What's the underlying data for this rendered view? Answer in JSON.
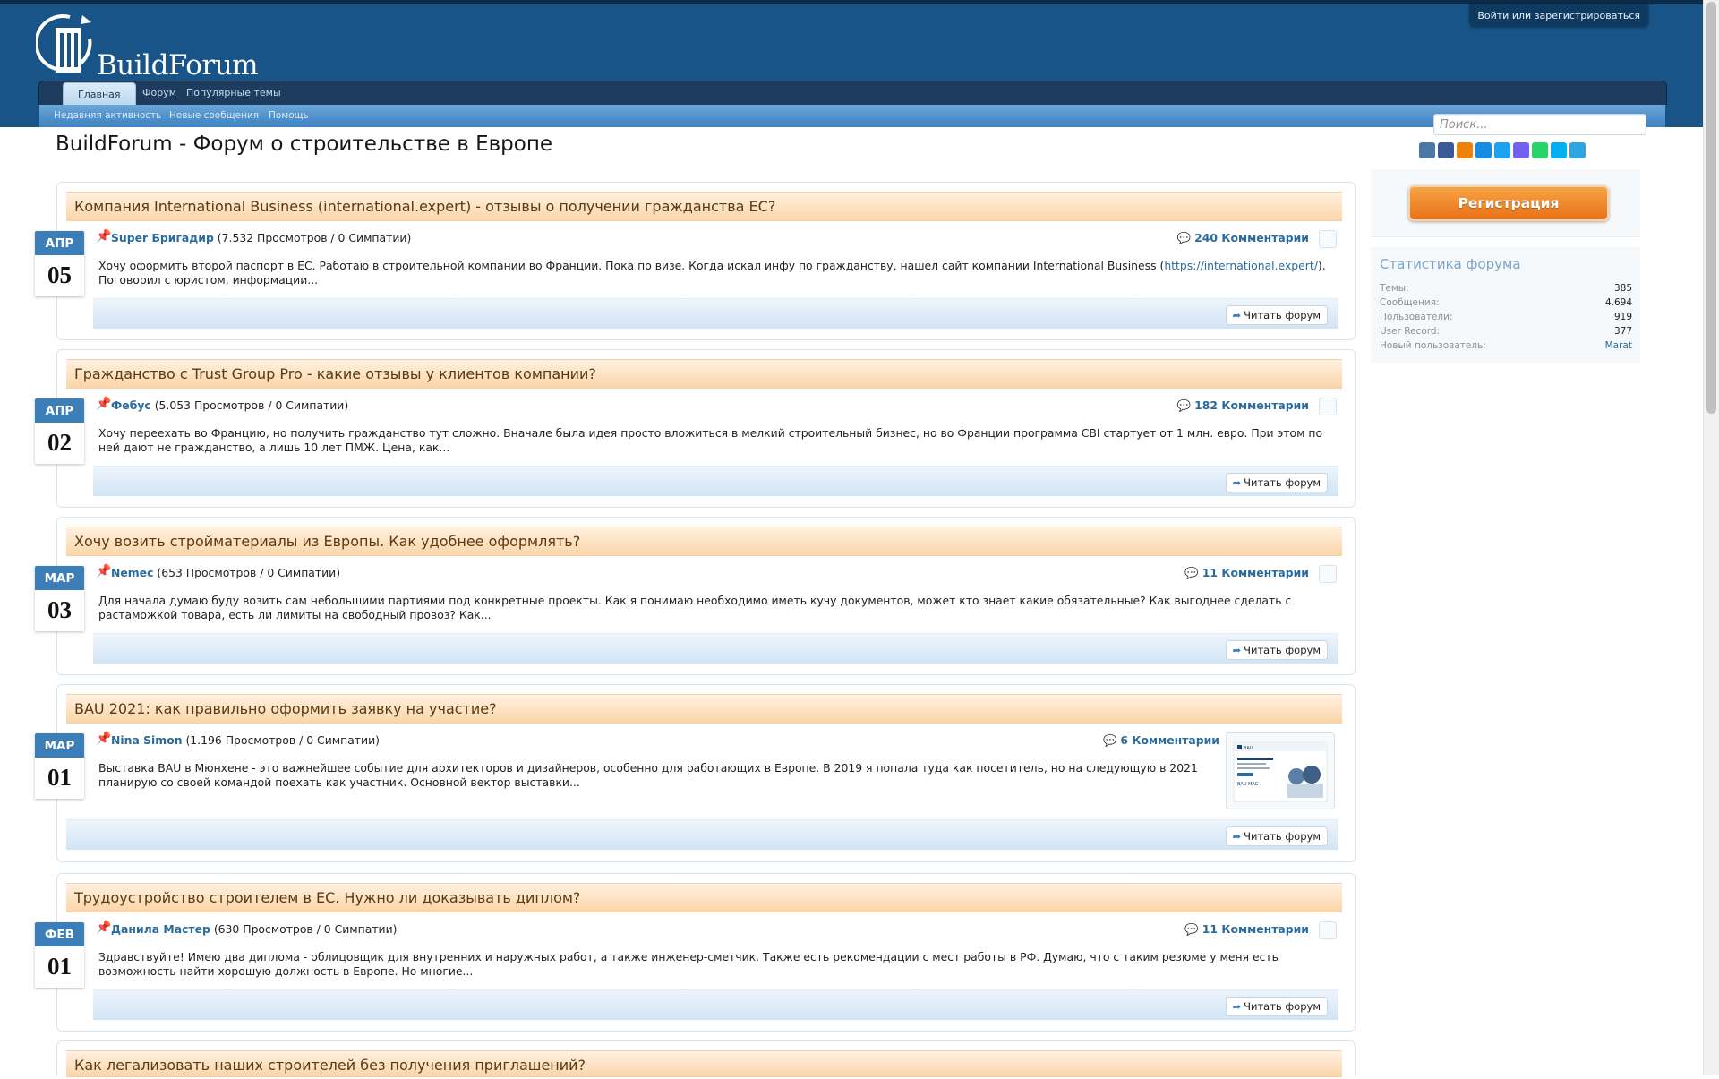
{
  "header": {
    "login_link": "Войти или зарегистрироваться",
    "logo_text": "BuildForum"
  },
  "nav": {
    "tabs": [
      {
        "label": "Главная",
        "active": true
      },
      {
        "label": "Форум"
      },
      {
        "label": "Популярные темы"
      }
    ],
    "subnav": [
      "Недавняя активность",
      "Новые сообщения",
      "Помощь"
    ]
  },
  "search": {
    "placeholder": "Поиск..."
  },
  "share_icons": [
    "vk-icon",
    "facebook-icon",
    "odnoklassniki-icon",
    "moimir-icon",
    "twitter-icon",
    "viber-icon",
    "whatsapp-icon",
    "skype-icon",
    "telegram-icon"
  ],
  "page_title": "BuildForum - Форум о строительстве в Европе",
  "threads": [
    {
      "title": "Компания International Business (international.expert) - отзывы о получении гражданства ЕС?",
      "user": "Super Бригадир",
      "stats": " (7.532 Просмотров / 0 Симпатии)",
      "comments": "240 Комментарии",
      "month": "АПР",
      "day": "05",
      "excerpt_before": "Хочу оформить второй паспорт в ЕС. Работаю в строительной компании во Франции. Пока по визе. Когда искал инфу по гражданству, нашел сайт компании International Business (",
      "excerpt_link": "https://international.expert/",
      "excerpt_after": "). Поговорил с юристом, информации...",
      "read_label": "Читать форум"
    },
    {
      "title": "Гражданство с Trust Group Pro - какие отзывы у клиентов компании?",
      "user": "Фебус",
      "stats": " (5.053 Просмотров / 0 Симпатии)",
      "comments": "182 Комментарии",
      "month": "АПР",
      "day": "02",
      "excerpt": "Хочу переехать во Францию, но получить гражданство тут сложно. Вначале была идея просто вложиться в мелкий строительный бизнес, но во Франции программа CBI стартует от 1 млн. евро. При этом по ней дают не гражданство, а лишь 10 лет ПМЖ. Цена, как...",
      "read_label": "Читать форум"
    },
    {
      "title": "Хочу возить стройматериалы из Европы. Как удобнее оформлять?",
      "user": "Nemec",
      "stats": " (653 Просмотров / 0 Симпатии)",
      "comments": "11 Комментарии",
      "month": "МАР",
      "day": "03",
      "excerpt": "Для начала думаю буду возить сам небольшими партиями под конкретные проекты. Как я понимаю необходимо иметь кучу документов, может кто знает какие обязательные? Как выгоднее сделать с растаможкой товара, есть ли лимиты на свободный провоз? Как...",
      "read_label": "Читать форум"
    },
    {
      "title": "BAU 2021: как правильно оформить заявку на участие?",
      "user": "Nina Simon",
      "stats": " (1.196 Просмотров / 0 Симпатии)",
      "comments": "6 Комментарии",
      "month": "МАР",
      "day": "01",
      "excerpt": "Выставка BAU в Мюнхене - это важнейшее событие для архитекторов и дизайнеров, особенно для работающих в Европе. В 2019 я попала туда как посетитель, но на следующую в 2021 планирую со своей командой поехать как участник. Основной вектор выставки...",
      "thumb_brand": "BAU",
      "thumb_caption": "BAU MAG",
      "read_label": "Читать форум"
    },
    {
      "title": "Трудоустройство строителем в ЕС. Нужно ли доказывать диплом?",
      "user": "Данила Мастер",
      "stats": " (630 Просмотров / 0 Симпатии)",
      "comments": "11 Комментарии",
      "month": "ФЕВ",
      "day": "01",
      "excerpt": "Здравствуйте! Имею два диплома - облицовщик для внутренних и наружных работ, а также инженер-сметчик. Также есть рекомендации с мест работы в РФ. Думаю, что с таким резюме у меня есть возможность найти хорошую должность в Европе. Но многие...",
      "read_label": "Читать форум"
    },
    {
      "title": "Как легализовать наших строителей без получения приглашений?"
    }
  ],
  "sidebar": {
    "register_label": "Регистрация",
    "stats_title": "Статистика форума",
    "stats": [
      {
        "label": "Темы:",
        "value": "385"
      },
      {
        "label": "Сообщения:",
        "value": "4.694"
      },
      {
        "label": "Пользователи:",
        "value": "919"
      },
      {
        "label": "User Record:",
        "value": "377"
      },
      {
        "label": "Новый пользователь:",
        "value": "Marat"
      }
    ]
  },
  "colors": {
    "header_bg": "#185487",
    "thread_header": "#fbd5a9",
    "date_badge": "#3c7fb8",
    "register_button": "#e9711a"
  }
}
